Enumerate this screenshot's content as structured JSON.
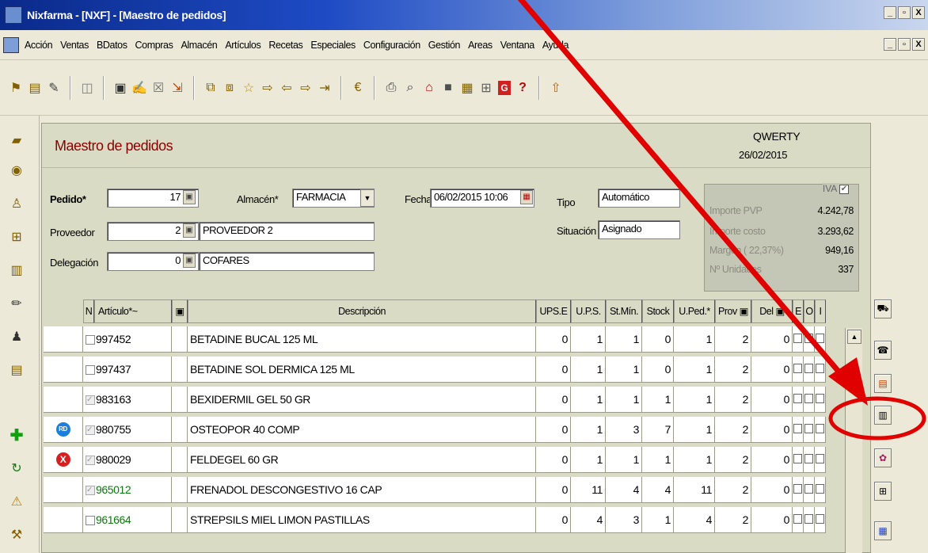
{
  "window": {
    "title": "Nixfarma - [NXF] - [Maestro de pedidos]"
  },
  "menu": [
    "Acción",
    "Ventas",
    "BDatos",
    "Compras",
    "Almacén",
    "Artículos",
    "Recetas",
    "Especiales",
    "Configuración",
    "Gestión",
    "Areas",
    "Ventana",
    "Ayuda"
  ],
  "header": {
    "title": "Maestro de pedidos",
    "user": "QWERTY",
    "date": "26/02/2015"
  },
  "form": {
    "pedido_label": "Pedido*",
    "pedido": "17",
    "proveedor_label": "Proveedor",
    "proveedor_code": "2",
    "proveedor_name": "PROVEEDOR 2",
    "delegacion_label": "Delegación",
    "delegacion_code": "0",
    "delegacion_name": "COFARES",
    "almacen_label": "Almacén*",
    "almacen": "FARMACIA",
    "fecha_label": "Fecha",
    "fecha": "06/02/2015 10:06",
    "tipo_label": "Tipo",
    "tipo": "Automático",
    "situacion_label": "Situación",
    "situacion": "Asignado"
  },
  "totals": {
    "iva_label": "IVA",
    "iva_checked": "✔",
    "rows": [
      {
        "label": "Importe PVP",
        "value": "4.242,78"
      },
      {
        "label": "Importe costo",
        "value": "3.293,62"
      },
      {
        "label": "Margen ( 22,37%)",
        "value": "949,16"
      },
      {
        "label": "Nº Unidades",
        "value": "337"
      }
    ]
  },
  "grid": {
    "headers": [
      "N",
      "Artículo*~",
      "Descripción",
      "UPS.E",
      "U.P.S.",
      "St.Mín.",
      "Stock",
      "U.Ped.*",
      "Prov",
      "Del",
      "E",
      "O",
      "I"
    ],
    "rows": [
      {
        "status": "",
        "checked": false,
        "code": "997452",
        "desc": "BETADINE BUCAL 125 ML",
        "upse": "0",
        "ups": "1",
        "stmin": "1",
        "stock": "0",
        "uped": "1",
        "prov": "2",
        "del": "0",
        "green": false
      },
      {
        "status": "",
        "checked": false,
        "code": "997437",
        "desc": "BETADINE SOL DERMICA 125 ML",
        "upse": "0",
        "ups": "1",
        "stmin": "1",
        "stock": "0",
        "uped": "1",
        "prov": "2",
        "del": "0",
        "green": false
      },
      {
        "status": "",
        "checked": true,
        "code": "983163",
        "desc": "BEXIDERMIL GEL 50 GR",
        "upse": "0",
        "ups": "1",
        "stmin": "1",
        "stock": "1",
        "uped": "1",
        "prov": "2",
        "del": "0",
        "green": false
      },
      {
        "status": "RD",
        "checked": true,
        "code": "980755",
        "desc": "OSTEOPOR 40 COMP",
        "upse": "0",
        "ups": "1",
        "stmin": "3",
        "stock": "7",
        "uped": "1",
        "prov": "2",
        "del": "0",
        "green": false
      },
      {
        "status": "X",
        "checked": true,
        "code": "980029",
        "desc": "FELDEGEL 60 GR",
        "upse": "0",
        "ups": "1",
        "stmin": "1",
        "stock": "1",
        "uped": "1",
        "prov": "2",
        "del": "0",
        "green": false
      },
      {
        "status": "",
        "checked": true,
        "code": "965012",
        "desc": "FRENADOL DESCONGESTIVO 16 CAP",
        "upse": "0",
        "ups": "11",
        "stmin": "4",
        "stock": "4",
        "uped": "11",
        "prov": "2",
        "del": "0",
        "green": true
      },
      {
        "status": "",
        "checked": false,
        "code": "961664",
        "desc": "STREPSILS MIEL LIMON PASTILLAS",
        "upse": "0",
        "ups": "4",
        "stmin": "3",
        "stock": "1",
        "uped": "4",
        "prov": "2",
        "del": "0",
        "green": true
      }
    ]
  },
  "colors": {
    "title_red": "#8B0000",
    "annotation_red": "#E00000",
    "code_green": "#0A7A0A"
  }
}
